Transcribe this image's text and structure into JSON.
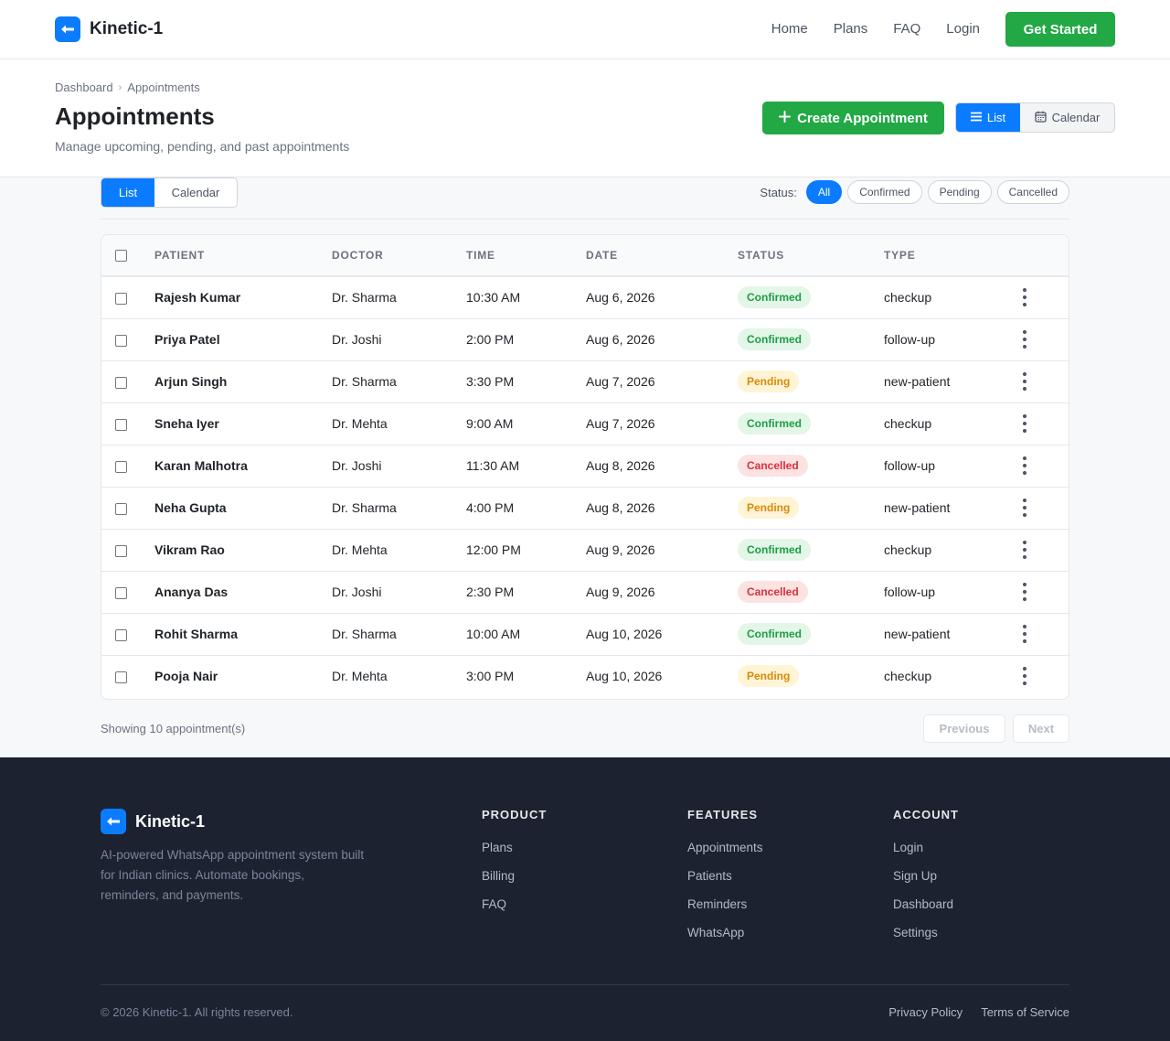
{
  "brand": {
    "name": "Kinetic-1"
  },
  "nav": {
    "links": [
      "Home",
      "Plans",
      "FAQ",
      "Login"
    ],
    "cta": "Get Started"
  },
  "header": {
    "breadcrumb": [
      "Dashboard",
      "Appointments"
    ],
    "breadcrumb_sep": "›",
    "title": "Appointments",
    "subtitle": "Manage upcoming, pending, and past appointments",
    "create_label": "Create Appointment",
    "view_list": "List",
    "view_calendar": "Calendar"
  },
  "filters": {
    "view_list": "List",
    "view_calendar": "Calendar",
    "status_label": "Status:",
    "status_options": [
      "All",
      "Confirmed",
      "Pending",
      "Cancelled"
    ],
    "active_status": "All"
  },
  "table": {
    "columns": [
      "PATIENT",
      "DOCTOR",
      "TIME",
      "DATE",
      "STATUS",
      "TYPE"
    ],
    "rows": [
      {
        "patient": "Rajesh Kumar",
        "doctor": "Dr. Sharma",
        "time": "10:30 AM",
        "date": "Aug 6, 2026",
        "status": "Confirmed",
        "type": "checkup"
      },
      {
        "patient": "Priya Patel",
        "doctor": "Dr. Joshi",
        "time": "2:00 PM",
        "date": "Aug 6, 2026",
        "status": "Confirmed",
        "type": "follow-up"
      },
      {
        "patient": "Arjun Singh",
        "doctor": "Dr. Sharma",
        "time": "3:30 PM",
        "date": "Aug 7, 2026",
        "status": "Pending",
        "type": "new-patient"
      },
      {
        "patient": "Sneha Iyer",
        "doctor": "Dr. Mehta",
        "time": "9:00 AM",
        "date": "Aug 7, 2026",
        "status": "Confirmed",
        "type": "checkup"
      },
      {
        "patient": "Karan Malhotra",
        "doctor": "Dr. Joshi",
        "time": "11:30 AM",
        "date": "Aug 8, 2026",
        "status": "Cancelled",
        "type": "follow-up"
      },
      {
        "patient": "Neha Gupta",
        "doctor": "Dr. Sharma",
        "time": "4:00 PM",
        "date": "Aug 8, 2026",
        "status": "Pending",
        "type": "new-patient"
      },
      {
        "patient": "Vikram Rao",
        "doctor": "Dr. Mehta",
        "time": "12:00 PM",
        "date": "Aug 9, 2026",
        "status": "Confirmed",
        "type": "checkup"
      },
      {
        "patient": "Ananya Das",
        "doctor": "Dr. Joshi",
        "time": "2:30 PM",
        "date": "Aug 9, 2026",
        "status": "Cancelled",
        "type": "follow-up"
      },
      {
        "patient": "Rohit Sharma",
        "doctor": "Dr. Sharma",
        "time": "10:00 AM",
        "date": "Aug 10, 2026",
        "status": "Confirmed",
        "type": "new-patient"
      },
      {
        "patient": "Pooja Nair",
        "doctor": "Dr. Mehta",
        "time": "3:00 PM",
        "date": "Aug 10, 2026",
        "status": "Pending",
        "type": "checkup"
      }
    ],
    "status_colors": {
      "Confirmed": {
        "bg": "#e3f6e8",
        "fg": "#1f9d45"
      },
      "Pending": {
        "bg": "#fff4d6",
        "fg": "#d98a06"
      },
      "Cancelled": {
        "bg": "#fde2e2",
        "fg": "#dc2f3a"
      }
    }
  },
  "pagination": {
    "summary": "Showing 10 appointment(s)",
    "previous": "Previous",
    "next": "Next"
  },
  "footer": {
    "brand": "Kinetic-1",
    "description": "AI-powered WhatsApp appointment system built for Indian clinics. Automate bookings, reminders, and payments.",
    "columns": [
      {
        "title": "PRODUCT",
        "links": [
          "Plans",
          "Billing",
          "FAQ"
        ]
      },
      {
        "title": "FEATURES",
        "links": [
          "Appointments",
          "Patients",
          "Reminders",
          "WhatsApp"
        ]
      },
      {
        "title": "ACCOUNT",
        "links": [
          "Login",
          "Sign Up",
          "Dashboard",
          "Settings"
        ]
      }
    ],
    "copyright": "© 2026 Kinetic-1. All rights reserved.",
    "legal": [
      "Privacy Policy",
      "Terms of Service"
    ]
  },
  "colors": {
    "primary": "#0b7cff",
    "success": "#22a845",
    "footer_bg": "#1c2230"
  },
  "icons": {
    "logo": "arrow-left-icon",
    "create": "plus-icon",
    "list": "list-icon",
    "calendar": "calendar-icon",
    "row_actions": "more-vertical-icon"
  }
}
